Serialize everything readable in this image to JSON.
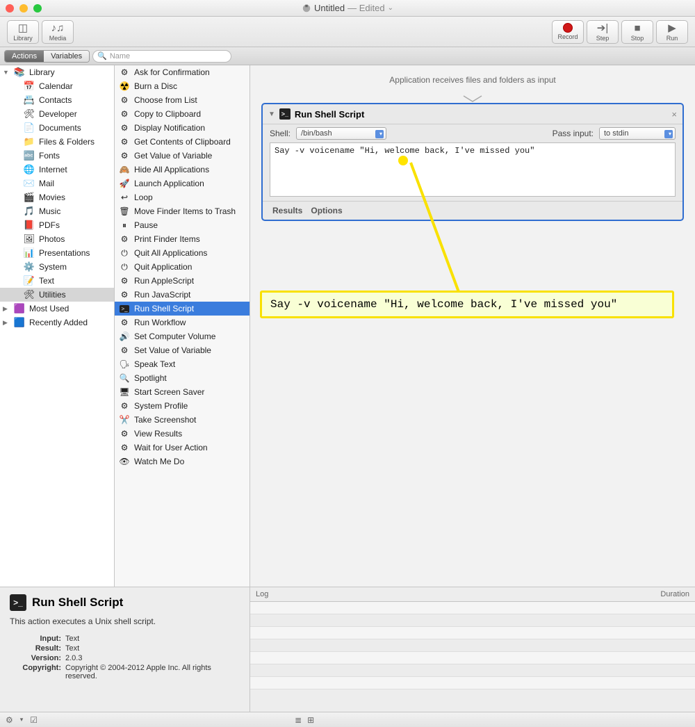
{
  "window": {
    "title_prefix": "Untitled",
    "title_suffix": "— Edited",
    "dropdown_glyph": "⌄"
  },
  "toolbar": {
    "library": "Library",
    "media": "Media",
    "record": "Record",
    "step": "Step",
    "stop": "Stop",
    "run": "Run"
  },
  "tabs": {
    "actions": "Actions",
    "variables": "Variables"
  },
  "search": {
    "placeholder": "Name",
    "icon": "🔍"
  },
  "library": [
    {
      "label": "Library",
      "level": 0,
      "icon": "📚",
      "expanded": true
    },
    {
      "label": "Calendar",
      "level": 1,
      "icon": "📅"
    },
    {
      "label": "Contacts",
      "level": 1,
      "icon": "📇"
    },
    {
      "label": "Developer",
      "level": 1,
      "icon": "🛠"
    },
    {
      "label": "Documents",
      "level": 1,
      "icon": "📄"
    },
    {
      "label": "Files & Folders",
      "level": 1,
      "icon": "📁"
    },
    {
      "label": "Fonts",
      "level": 1,
      "icon": "🔤"
    },
    {
      "label": "Internet",
      "level": 1,
      "icon": "🌐"
    },
    {
      "label": "Mail",
      "level": 1,
      "icon": "✉️"
    },
    {
      "label": "Movies",
      "level": 1,
      "icon": "🎬"
    },
    {
      "label": "Music",
      "level": 1,
      "icon": "🎵"
    },
    {
      "label": "PDFs",
      "level": 1,
      "icon": "📕"
    },
    {
      "label": "Photos",
      "level": 1,
      "icon": "🖼"
    },
    {
      "label": "Presentations",
      "level": 1,
      "icon": "📊"
    },
    {
      "label": "System",
      "level": 1,
      "icon": "⚙️"
    },
    {
      "label": "Text",
      "level": 1,
      "icon": "📝"
    },
    {
      "label": "Utilities",
      "level": 1,
      "icon": "🛠",
      "selected": true
    },
    {
      "label": "Most Used",
      "level": 0,
      "icon": "🟪"
    },
    {
      "label": "Recently Added",
      "level": 0,
      "icon": "🟦"
    }
  ],
  "actions": [
    "Ask for Confirmation",
    "Burn a Disc",
    "Choose from List",
    "Copy to Clipboard",
    "Display Notification",
    "Get Contents of Clipboard",
    "Get Value of Variable",
    "Hide All Applications",
    "Launch Application",
    "Loop",
    "Move Finder Items to Trash",
    "Pause",
    "Print Finder Items",
    "Quit All Applications",
    "Quit Application",
    "Run AppleScript",
    "Run JavaScript",
    "Run Shell Script",
    "Run Workflow",
    "Set Computer Volume",
    "Set Value of Variable",
    "Speak Text",
    "Spotlight",
    "Start Screen Saver",
    "System Profile",
    "Take Screenshot",
    "View Results",
    "Wait for User Action",
    "Watch Me Do"
  ],
  "actions_selected": "Run Shell Script",
  "workspace": {
    "hint": "Application receives files and folders as input",
    "card": {
      "title": "Run Shell Script",
      "shell_label": "Shell:",
      "shell_value": "/bin/bash",
      "pass_label": "Pass input:",
      "pass_value": "to stdin",
      "script": "Say -v voicename \"Hi, welcome back, I've missed you\"",
      "results": "Results",
      "options": "Options",
      "close": "×",
      "collapse": "▼"
    }
  },
  "callout_text": "Say -v voicename \"Hi, welcome back, I've missed you\"",
  "description": {
    "title": "Run Shell Script",
    "body": "This action executes a Unix shell script.",
    "rows": [
      {
        "label": "Input:",
        "value": "Text"
      },
      {
        "label": "Result:",
        "value": "Text"
      },
      {
        "label": "Version:",
        "value": "2.0.3"
      },
      {
        "label": "Copyright:",
        "value": "Copyright © 2004-2012 Apple Inc.  All rights reserved."
      }
    ]
  },
  "log": {
    "col_log": "Log",
    "col_duration": "Duration"
  },
  "status": {
    "gear": "⚙︎",
    "chev": "▾",
    "box": "☑︎",
    "icon1": "≣",
    "icon2": "⊞"
  }
}
